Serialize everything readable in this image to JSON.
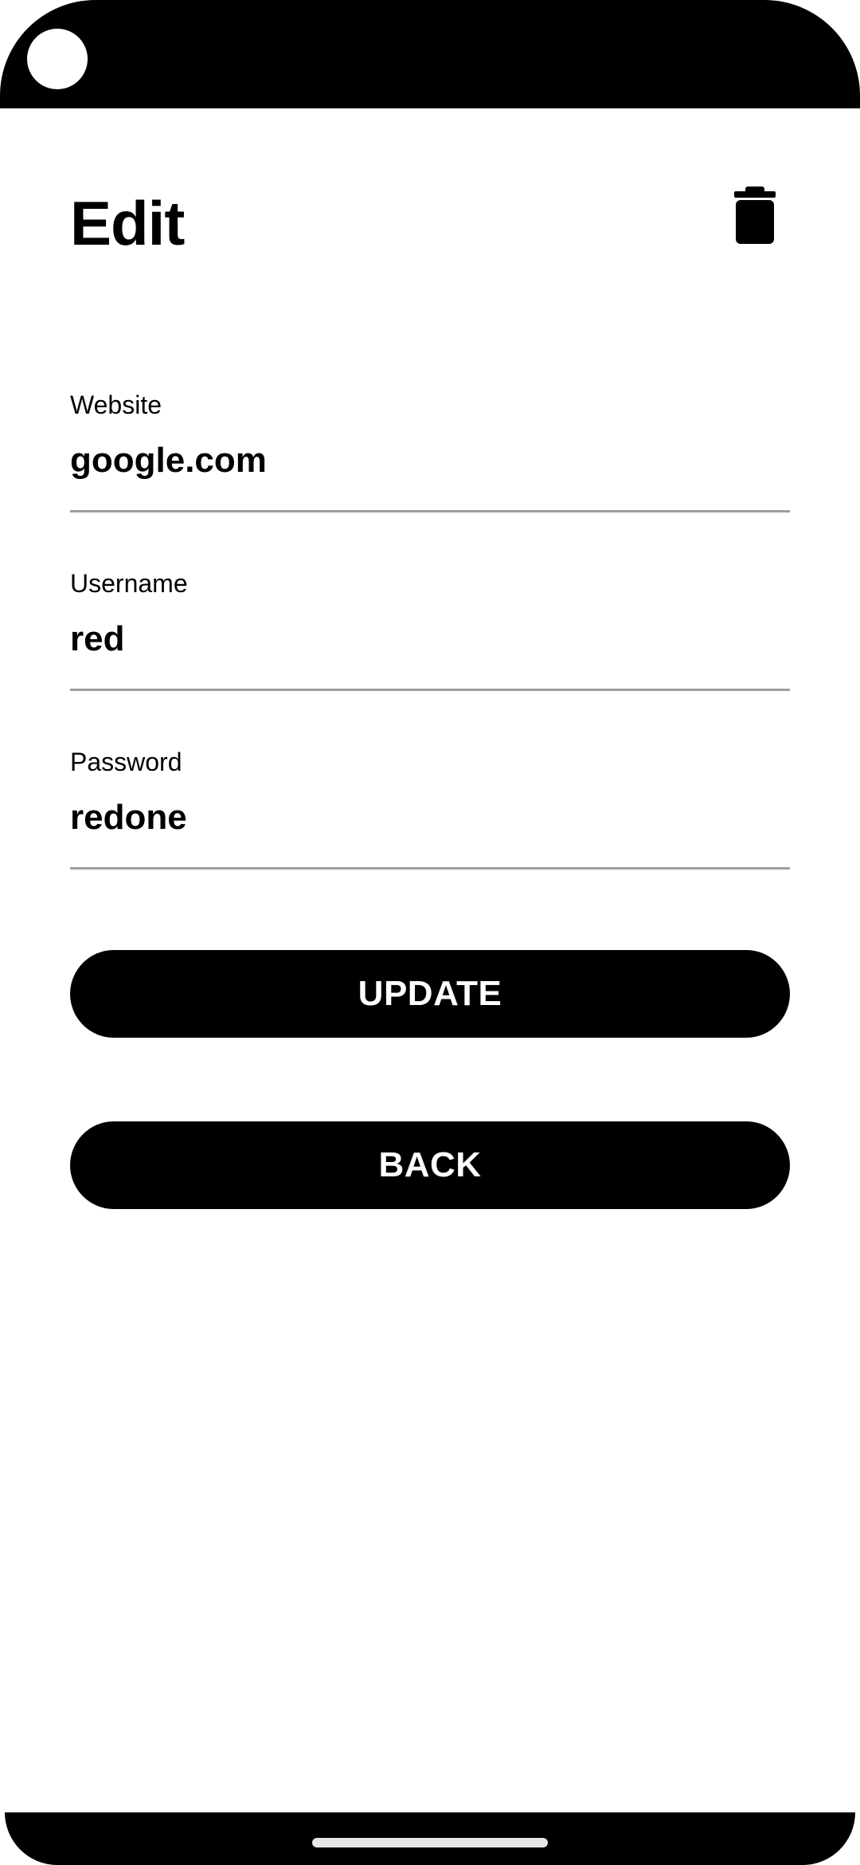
{
  "header": {
    "title": "Edit",
    "delete_icon": "trash-icon"
  },
  "form": {
    "website": {
      "label": "Website",
      "value": "google.com"
    },
    "username": {
      "label": "Username",
      "value": "red"
    },
    "password": {
      "label": "Password",
      "value": "redone"
    }
  },
  "actions": {
    "update_label": "UPDATE",
    "back_label": "BACK"
  },
  "colors": {
    "primary": "#000000",
    "background": "#ffffff",
    "underline": "#9e9e9e"
  }
}
